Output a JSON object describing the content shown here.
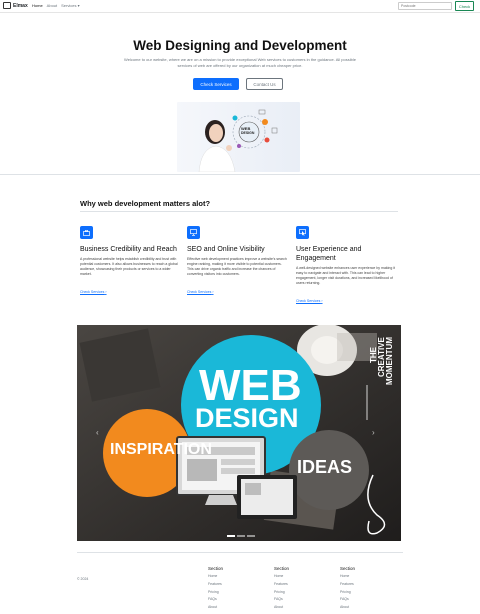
{
  "navbar": {
    "brand": "Elmax",
    "links": [
      {
        "label": "Home",
        "active": true
      },
      {
        "label": "About",
        "active": false
      },
      {
        "label": "Services",
        "active": false,
        "has_dropdown": true
      }
    ],
    "search_placeholder": "Postcode",
    "search_button": "Check"
  },
  "hero": {
    "title": "Web Designing and Development",
    "lead": "Welcome to our website, where we are on a mission to provide exceptional Web services to customers in the guidance. All possible services of web are offered by our organization at much cheaper price.",
    "primary_button": "Check Services",
    "secondary_button": "Contact Us"
  },
  "features": {
    "title": "Why web development matters alot?",
    "items": [
      {
        "icon": "briefcase-icon",
        "title": "Business Credibility and Reach",
        "text": "A professional website helps establish credibility and trust with potential customers. It also allows businesses to reach a global audience, showcasing their products or services to a wider market.",
        "link": "Check Services"
      },
      {
        "icon": "monitor-icon",
        "title": "SEO and Online Visibility",
        "text": "Effective web development practices improve a website's search engine ranking, making it more visible to potential customers. This can drive organic traffic and increase the chances of converting visitors into customers.",
        "link": "Check Services"
      },
      {
        "icon": "cursor-icon",
        "title": "User Experience and Engagement",
        "text": "A well-designed website enhances user experience by making it easy to navigate and interact with. This can lead to higher engagement, longer visit durations, and increased likelihood of users returning.",
        "link": "Check Services"
      }
    ]
  },
  "carousel": {
    "image_text": {
      "web": "WEB",
      "design": "DESIGN",
      "inspiration": "INSPIRATION",
      "ideas": "IDEAS",
      "the": "THE",
      "creative": "CREATIVE",
      "momentum": "MOMENTUM"
    },
    "active_slide": 1,
    "slide_count": 3
  },
  "footer": {
    "copyright": "© 2024",
    "columns": [
      {
        "heading": "Section",
        "links": [
          "Home",
          "Features",
          "Pricing",
          "FAQs",
          "About"
        ]
      },
      {
        "heading": "Section",
        "links": [
          "Home",
          "Features",
          "Pricing",
          "FAQs",
          "About"
        ]
      },
      {
        "heading": "Section",
        "links": [
          "Home",
          "Features",
          "Pricing",
          "FAQs",
          "About"
        ]
      }
    ]
  },
  "colors": {
    "primary": "#0d6efd",
    "success": "#198754",
    "muted": "#6c757d",
    "orange": "#f28a1e",
    "cyan": "#1ab8d8"
  }
}
